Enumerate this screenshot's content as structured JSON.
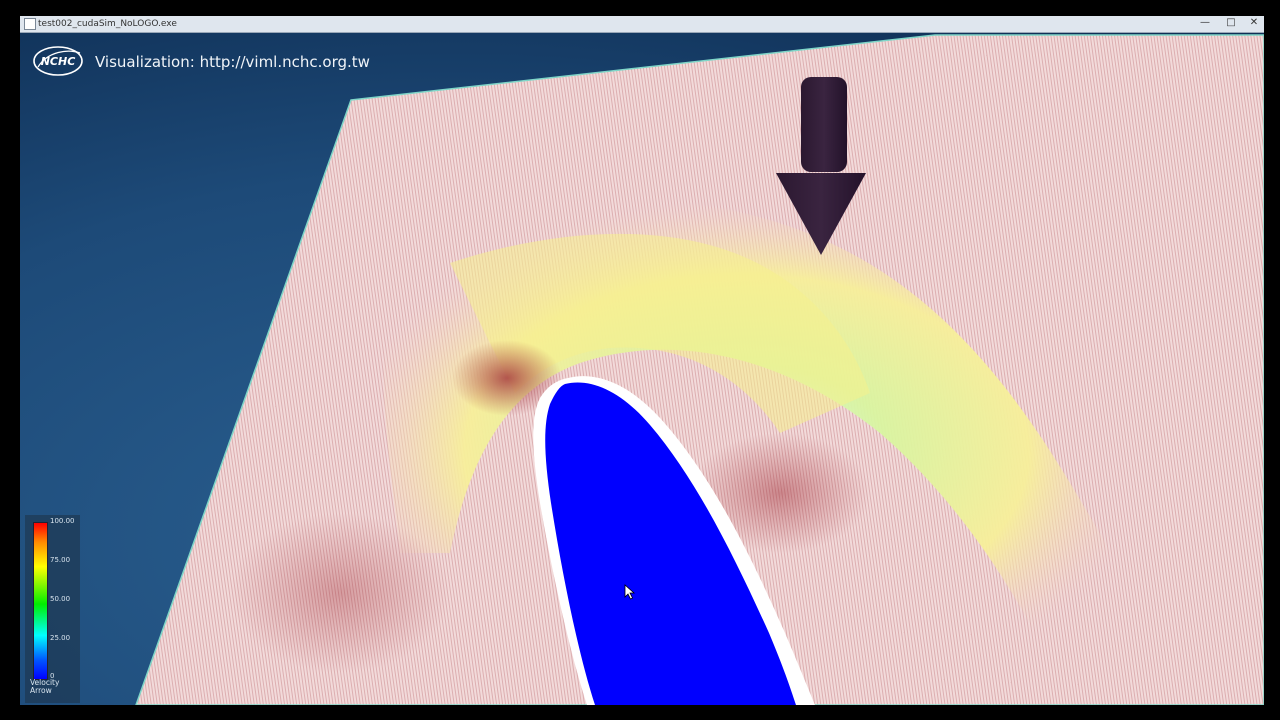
{
  "window": {
    "title": "test002_cudaSim_NoLOGO.exe",
    "buttons": {
      "minimize": "—",
      "maximize": "□",
      "close": "✕"
    }
  },
  "overlay": {
    "logo_text": "NCHC",
    "label": "Visualization: http://viml.nchc.org.tw"
  },
  "legend": {
    "ticks": [
      "100.00",
      "75.00",
      "50.00",
      "25.00",
      "0"
    ],
    "title_line1": "Velocity",
    "title_line2": "Arrow"
  },
  "icons": {
    "flow_direction": "down-arrow-icon",
    "pointer": "mouse-cursor-icon"
  },
  "colors": {
    "background": "#1d4a78",
    "plane": "#efd6d6",
    "obstacle": "#0000ff",
    "arrow": "#2a1830"
  }
}
